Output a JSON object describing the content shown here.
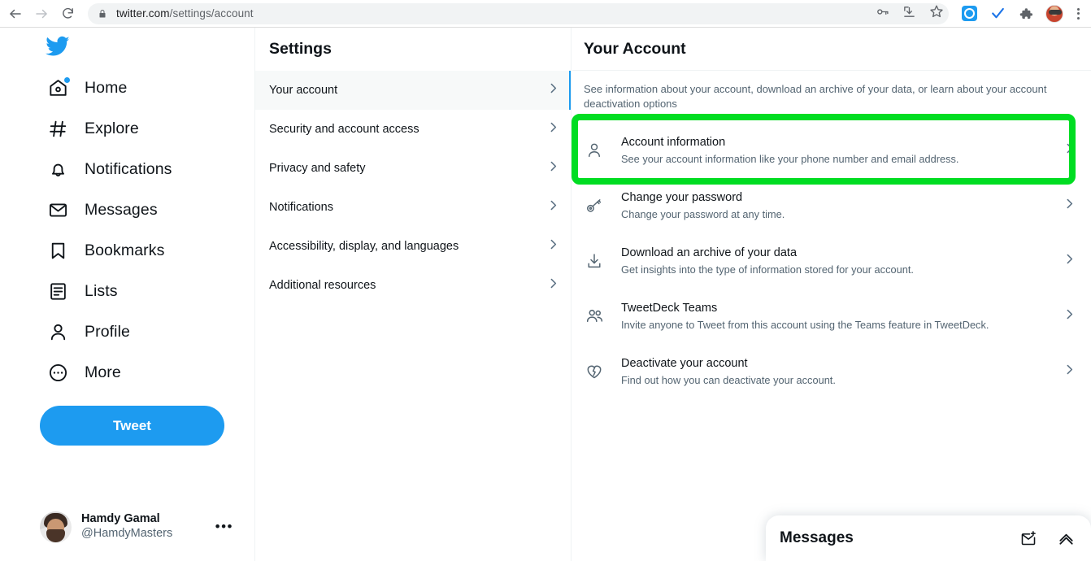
{
  "browser": {
    "back_icon": "back-arrow-icon",
    "forward_icon": "forward-arrow-icon",
    "reload_icon": "reload-icon",
    "lock_icon": "lock-icon",
    "url_domain": "twitter.com",
    "url_path": "/settings/account",
    "omnibox_actions": [
      "password-key-icon",
      "install-app-icon",
      "bookmark-star-icon"
    ],
    "extensions": [
      "blue-circle-extension-icon",
      "blue-check-extension-icon",
      "puzzle-piece-icon"
    ],
    "profile_avatar": "chrome-profile-avatar",
    "menu_icon": "chrome-menu-kebab-icon"
  },
  "leftnav": {
    "logo": "twitter-bird-logo",
    "items": [
      {
        "label": "Home",
        "icon": "home-icon",
        "badge": true
      },
      {
        "label": "Explore",
        "icon": "hashtag-icon",
        "badge": false
      },
      {
        "label": "Notifications",
        "icon": "bell-icon",
        "badge": false
      },
      {
        "label": "Messages",
        "icon": "envelope-icon",
        "badge": false
      },
      {
        "label": "Bookmarks",
        "icon": "bookmark-icon",
        "badge": false
      },
      {
        "label": "Lists",
        "icon": "list-icon",
        "badge": false
      },
      {
        "label": "Profile",
        "icon": "person-icon",
        "badge": false
      },
      {
        "label": "More",
        "icon": "more-circle-icon",
        "badge": false
      }
    ],
    "tweet_button": "Tweet",
    "profile": {
      "name": "Hamdy Gamal",
      "handle": "@HamdyMasters",
      "more": "•••"
    }
  },
  "settings": {
    "title": "Settings",
    "items": [
      {
        "label": "Your account",
        "active": true
      },
      {
        "label": "Security and account access",
        "active": false
      },
      {
        "label": "Privacy and safety",
        "active": false
      },
      {
        "label": "Notifications",
        "active": false
      },
      {
        "label": "Accessibility, display, and languages",
        "active": false
      },
      {
        "label": "Additional resources",
        "active": false
      }
    ]
  },
  "account_panel": {
    "title": "Your Account",
    "description": "See information about your account, download an archive of your data, or learn about your account deactivation options",
    "rows": [
      {
        "title": "Account information",
        "subtitle": "See your account information like your phone number and email address.",
        "icon": "person-icon",
        "highlighted": true
      },
      {
        "title": "Change your password",
        "subtitle": "Change your password at any time.",
        "icon": "key-icon",
        "highlighted": false
      },
      {
        "title": "Download an archive of your data",
        "subtitle": "Get insights into the type of information stored for your account.",
        "icon": "download-icon",
        "highlighted": false
      },
      {
        "title": "TweetDeck Teams",
        "subtitle": "Invite anyone to Tweet from this account using the Teams feature in TweetDeck.",
        "icon": "people-group-icon",
        "highlighted": false
      },
      {
        "title": "Deactivate your account",
        "subtitle": "Find out how you can deactivate your account.",
        "icon": "broken-heart-icon",
        "highlighted": false
      }
    ]
  },
  "messages_dock": {
    "title": "Messages",
    "new_message_icon": "new-message-envelope-icon",
    "expand_icon": "chevron-up-icon"
  },
  "colors": {
    "twitter_blue": "#1d9bf0",
    "highlight_green": "#00dd22",
    "text_primary": "#0f1419",
    "text_secondary": "#536471"
  }
}
